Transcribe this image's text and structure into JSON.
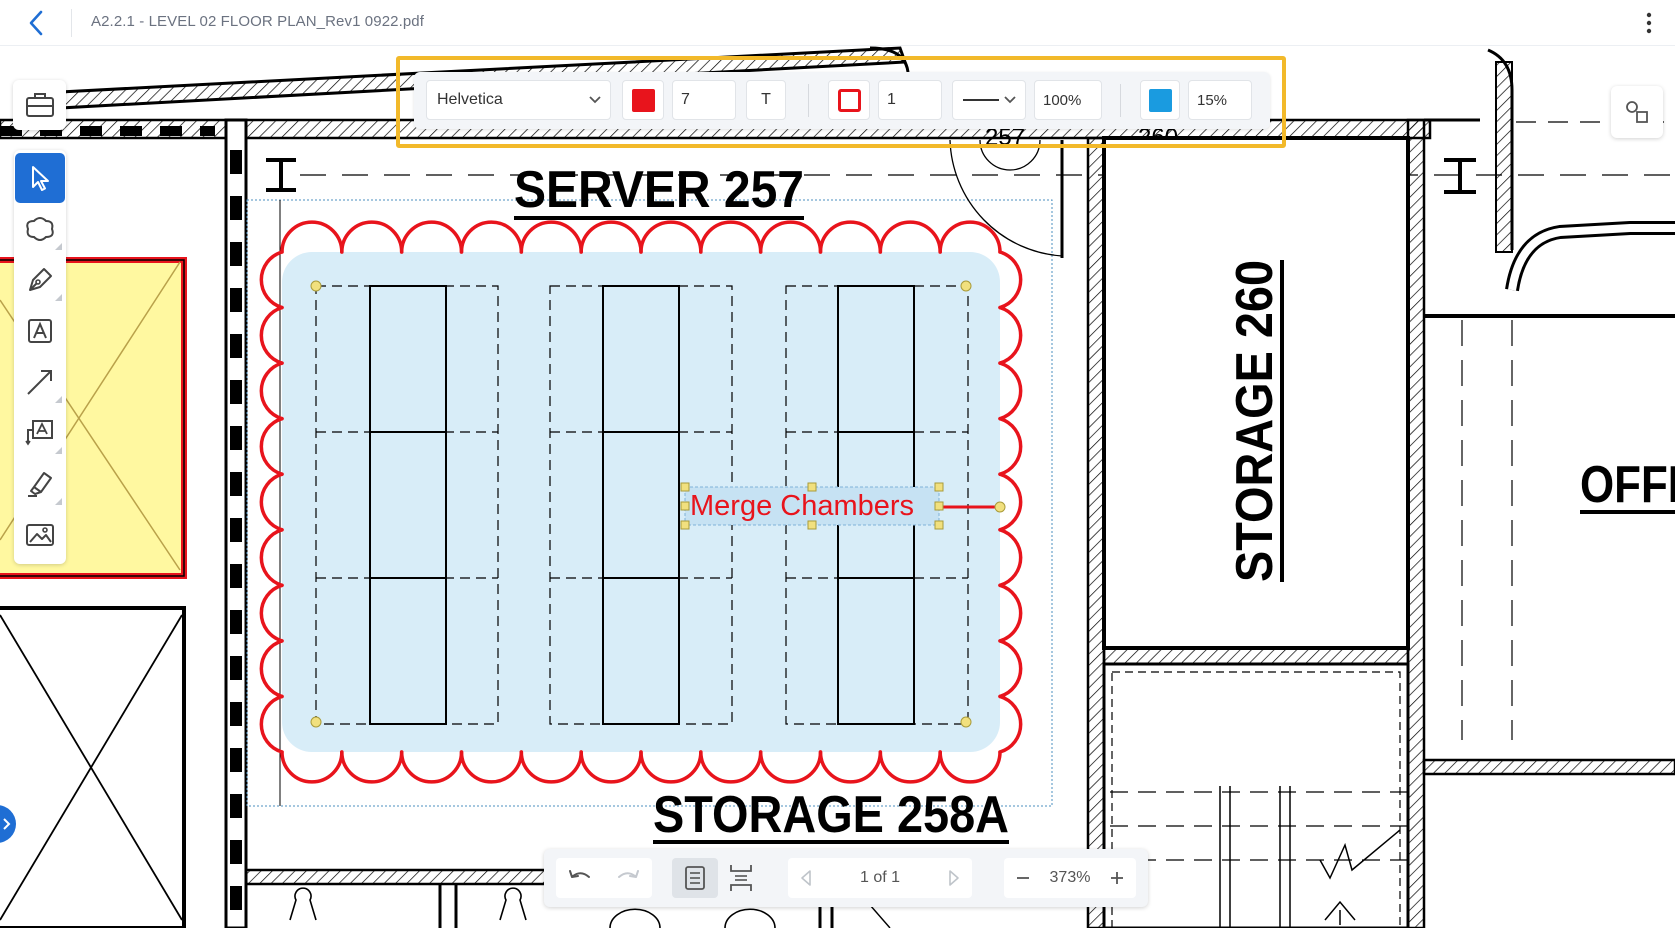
{
  "header": {
    "doc_title": "A2.2.1 - LEVEL 02 FLOOR PLAN_Rev1 0922.pdf"
  },
  "format_toolbar": {
    "font": "Helvetica",
    "font_color": "#e8141c",
    "font_size": "7",
    "text_style_label": "T",
    "stroke_color": "#e8141c",
    "stroke_width": "1",
    "opacity": "100%",
    "fill_color": "#1a9be0",
    "fill_opacity": "15%"
  },
  "drawing": {
    "room_server": "SERVER   257",
    "room_storage_258a": "STORAGE   258A",
    "room_storage_260": "STORAGE   260",
    "room_office": "OFFI",
    "callout_text": "Merge Chambers",
    "door_tag_1": "257",
    "door_tag_2": "260"
  },
  "bottom_bar": {
    "page_indicator": "1 of 1",
    "zoom": "373%"
  },
  "colors": {
    "accent": "#1f6ed4",
    "markup_red": "#e8141c",
    "markup_fill": "#d8edf8",
    "highlight": "#f2b92a",
    "yellow_area": "#fff8a0"
  }
}
